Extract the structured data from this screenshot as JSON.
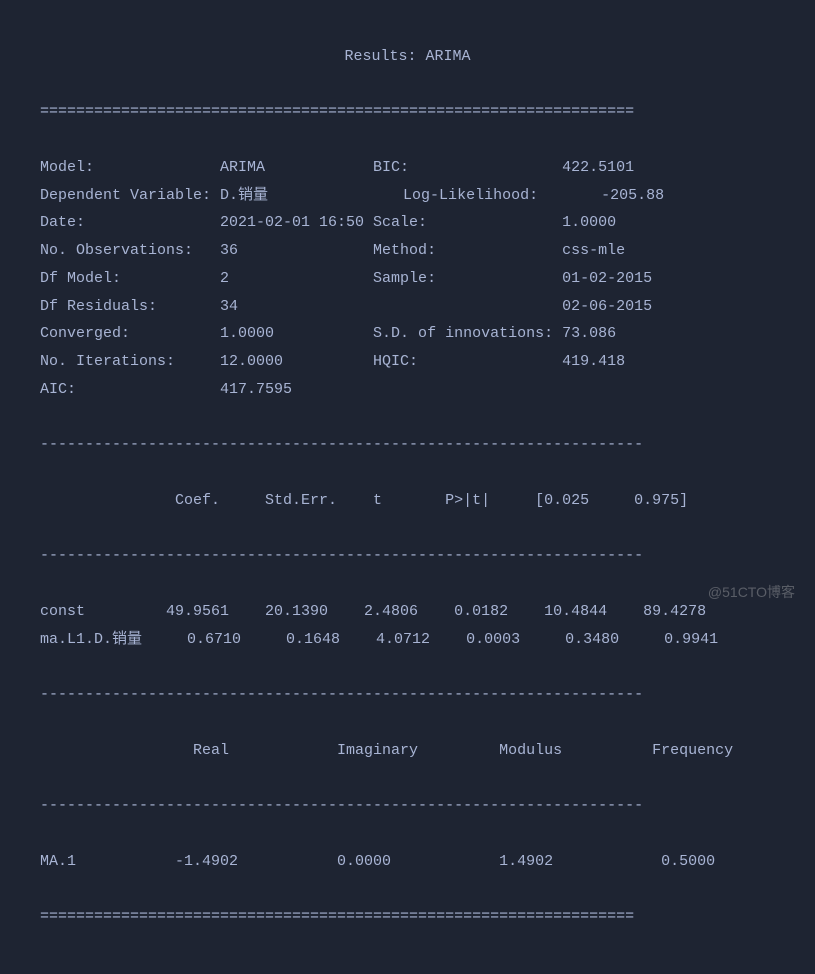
{
  "title": "Results: ARIMA",
  "divider_double": "==================================================================",
  "divider_single": "-------------------------------------------------------------------",
  "summary_left": [
    {
      "label": "Model:",
      "value": "ARIMA"
    },
    {
      "label": "Dependent Variable:",
      "value": "D.销量"
    },
    {
      "label": "Date:",
      "value": "2021-02-01 16:50"
    },
    {
      "label": "No. Observations:",
      "value": "36"
    },
    {
      "label": "Df Model:",
      "value": "2"
    },
    {
      "label": "Df Residuals:",
      "value": "34"
    },
    {
      "label": "Converged:",
      "value": "1.0000"
    },
    {
      "label": "No. Iterations:",
      "value": "12.0000"
    },
    {
      "label": "AIC:",
      "value": "417.7595"
    }
  ],
  "summary_right": [
    {
      "label": "BIC:",
      "value": "422.5101"
    },
    {
      "label": "Log-Likelihood:",
      "value": "-205.88"
    },
    {
      "label": "Scale:",
      "value": "1.0000"
    },
    {
      "label": "Method:",
      "value": "css-mle"
    },
    {
      "label": "Sample:",
      "value": "01-02-2015"
    },
    {
      "label": "",
      "value": "02-06-2015"
    },
    {
      "label": "S.D. of innovations:",
      "value": "73.086"
    },
    {
      "label": "HQIC:",
      "value": "419.418"
    },
    {
      "label": "",
      "value": ""
    }
  ],
  "coef_header": {
    "c1": "Coef.",
    "c2": "Std.Err.",
    "c3": "t",
    "c4": "P>|t|",
    "c5": "[0.025",
    "c6": "0.975]"
  },
  "coef_rows": [
    {
      "name": "const",
      "coef": "49.9561",
      "stderr": "20.1390",
      "t": "2.4806",
      "p": "0.0182",
      "lo": "10.4844",
      "hi": "89.4278"
    },
    {
      "name": "ma.L1.D.销量",
      "coef": "0.6710",
      "stderr": "0.1648",
      "t": "4.0712",
      "p": "0.0003",
      "lo": "0.3480",
      "hi": "0.9941"
    }
  ],
  "roots_header": {
    "c1": "Real",
    "c2": "Imaginary",
    "c3": "Modulus",
    "c4": "Frequency"
  },
  "roots_rows": [
    {
      "name": "MA.1",
      "real": "-1.4902",
      "imaginary": "0.0000",
      "modulus": "1.4902",
      "frequency": "0.5000"
    }
  ],
  "watermark": "@51CTO博客"
}
